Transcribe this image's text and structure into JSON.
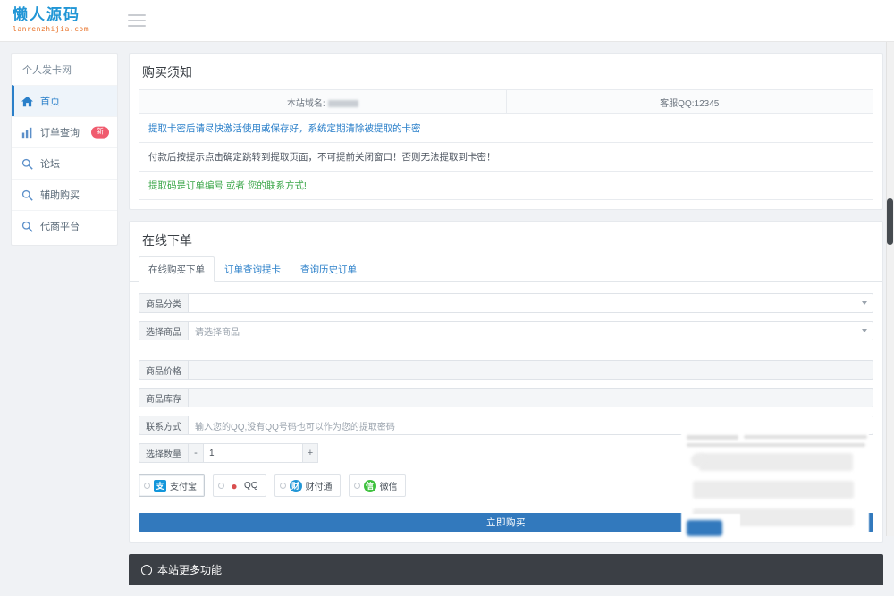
{
  "navbar": {
    "logo_cn": "懒人源码",
    "logo_en": "lanrenzhijia.com",
    "menu_toggle_name": "hamburger-menu"
  },
  "sidebar": {
    "title": "个人发卡网",
    "items": [
      {
        "label": "首页",
        "icon": "home-icon",
        "active": true,
        "badge": ""
      },
      {
        "label": "订单查询",
        "icon": "chart-icon",
        "active": false,
        "badge": "新"
      },
      {
        "label": "论坛",
        "icon": "search-icon",
        "active": false,
        "badge": ""
      },
      {
        "label": "辅助购买",
        "icon": "search-icon",
        "active": false,
        "badge": ""
      },
      {
        "label": "代商平台",
        "icon": "search-icon",
        "active": false,
        "badge": ""
      }
    ]
  },
  "notice_panel": {
    "title": "购买须知",
    "info_left_label": "本站域名:",
    "info_left_value": "",
    "info_right": "客服QQ:12345",
    "notices": [
      {
        "text": "提取卡密后请尽快激活使用或保存好，系统定期清除被提取的卡密",
        "style": "blue"
      },
      {
        "text": "付款后按提示点击确定跳转到提取页面，不可提前关闭窗口！否则无法提取到卡密！",
        "style": "gray"
      },
      {
        "text": "提取码是订单编号 或者 您的联系方式!",
        "style": "green"
      }
    ]
  },
  "order_panel": {
    "title": "在线下单",
    "tabs": [
      {
        "label": "在线购买下单",
        "active": true
      },
      {
        "label": "订单查询提卡",
        "active": false
      },
      {
        "label": "查询历史订单",
        "active": false
      }
    ],
    "fields": {
      "category_label": "商品分类",
      "category_value": "",
      "product_label": "选择商品",
      "product_placeholder": "请选择商品",
      "price_label": "商品价格",
      "price_value": "",
      "stock_label": "商品库存",
      "stock_value": "",
      "contact_label": "联系方式",
      "contact_placeholder": "输入您的QQ,没有QQ号码也可以作为您的提取密码",
      "quantity_label": "选择数量",
      "quantity_value": "1",
      "quantity_minus": "-",
      "quantity_plus": "+"
    },
    "payments": [
      {
        "label": "支付宝",
        "icon": "alipay-icon",
        "glyph": "支",
        "selected": true
      },
      {
        "label": "QQ",
        "icon": "qq-icon",
        "glyph": "Q",
        "selected": false
      },
      {
        "label": "财付通",
        "icon": "tenpay-icon",
        "glyph": "财",
        "selected": false
      },
      {
        "label": "微信",
        "icon": "wechat-icon",
        "glyph": "信",
        "selected": false
      }
    ],
    "buy_button": "立即购买"
  },
  "footer": {
    "title": "本站更多功能",
    "icon": "gear-icon"
  },
  "colors": {
    "brand_blue": "#2a7fc9",
    "button_blue": "#3279bd",
    "badge_red": "#f05b6e",
    "notice_green": "#3aa648",
    "logo_orange": "#e8732a",
    "footer_dark": "#3b3f45"
  },
  "scrollbar": {
    "name": "vertical-scrollbar"
  }
}
